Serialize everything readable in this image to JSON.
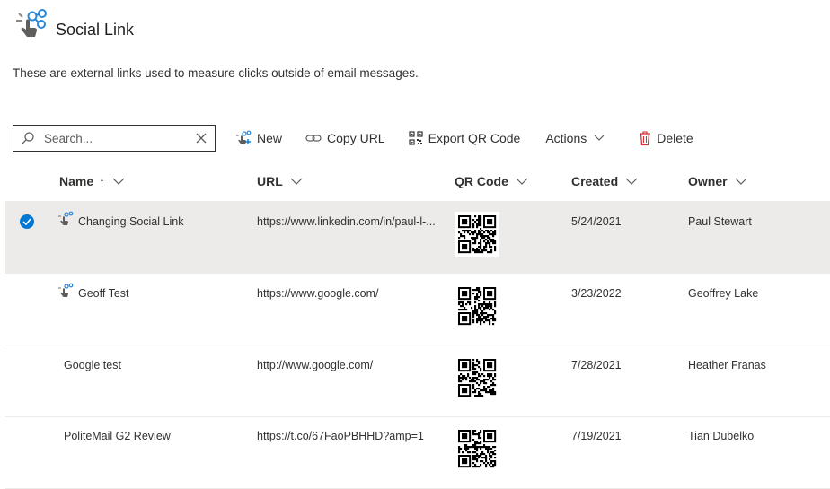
{
  "header": {
    "title": "Social Link"
  },
  "subtitle": "These are external links used to measure clicks outside of email messages.",
  "toolbar": {
    "search_placeholder": "Search...",
    "new_label": "New",
    "copy_url_label": "Copy URL",
    "export_qr_label": "Export QR Code",
    "actions_label": "Actions",
    "delete_label": "Delete"
  },
  "columns": {
    "name": "Name",
    "name_sort": "↑",
    "url": "URL",
    "qr": "QR Code",
    "created": "Created",
    "owner": "Owner"
  },
  "rows": [
    {
      "name": "Changing Social Link",
      "url": "https://www.linkedin.com/in/paul-l-...",
      "created": "5/24/2021",
      "owner": "Paul Stewart",
      "selected": true,
      "has_icon": true
    },
    {
      "name": "Geoff Test",
      "url": "https://www.google.com/",
      "created": "3/23/2022",
      "owner": "Geoffrey Lake",
      "selected": false,
      "has_icon": true
    },
    {
      "name": "Google test",
      "url": "http://www.google.com/",
      "created": "7/28/2021",
      "owner": "Heather Franas",
      "selected": false,
      "has_icon": false
    },
    {
      "name": "PoliteMail G2 Review",
      "url": "https://t.co/67FaoPBHHD?amp=1",
      "created": "7/19/2021",
      "owner": "Tian Dubelko",
      "selected": false,
      "has_icon": false
    }
  ],
  "colors": {
    "accent": "#0078d4",
    "selected_row": "#edebe9",
    "delete_icon": "#d13438"
  }
}
